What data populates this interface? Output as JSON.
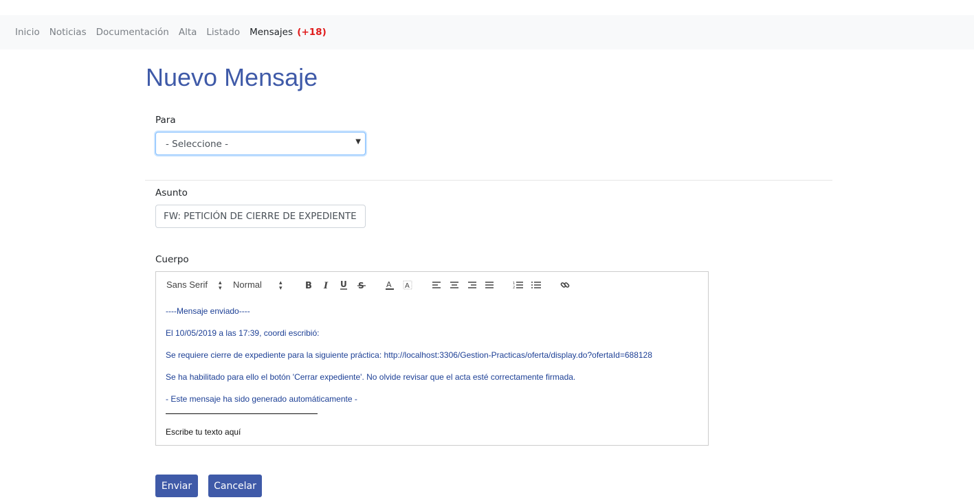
{
  "nav": {
    "items": [
      "Inicio",
      "Noticias",
      "Documentación",
      "Alta",
      "Listado"
    ],
    "active_label": "Mensajes",
    "badge": "(+18)"
  },
  "page": {
    "title": "Nuevo Mensaje"
  },
  "form": {
    "to_label": "Para",
    "to_value": "- Seleccione -",
    "subject_label": "Asunto",
    "subject_value": "FW: PETICIÓN DE CIERRE DE EXPEDIENTE",
    "body_label": "Cuerpo"
  },
  "toolbar": {
    "font": "Sans Serif",
    "size": "Normal",
    "icons": [
      "bold-icon",
      "italic-icon",
      "underline-icon",
      "strike-icon",
      "text-color-icon",
      "background-color-icon",
      "align-left-icon",
      "align-center-icon",
      "align-right-icon",
      "align-justify-icon",
      "ordered-list-icon",
      "bullet-list-icon",
      "link-icon"
    ]
  },
  "body": {
    "lines": [
      "----Mensaje enviado----",
      " El 10/05/2019 a las 17:39, coordi escribió:",
      "Se requiere cierre de expediente para la siguiente práctica: http://localhost:3306/Gestion-Practicas/oferta/display.do?ofertaId=688128",
      " Se ha habilitado para ello el botón 'Cerrar expediente'. No olvide revisar que el acta esté correctamente firmada.",
      " - Este mensaje ha sido generado automáticamente -"
    ],
    "placeholder_text": "Escribe tu texto aquí"
  },
  "buttons": {
    "send": "Enviar",
    "cancel": "Cancelar"
  },
  "colors": {
    "accent": "#3f5aa8",
    "badge": "#e01b1b",
    "quoted_text": "#1c3f95",
    "navbar_bg": "#f8f9fa"
  }
}
